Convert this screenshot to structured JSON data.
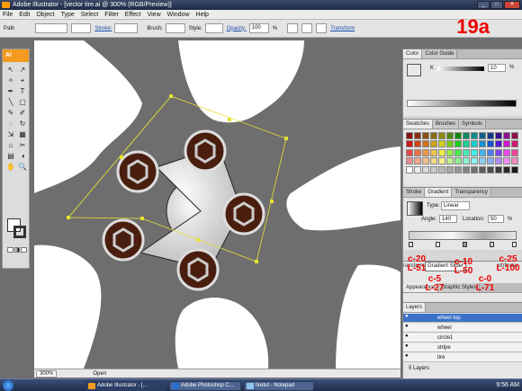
{
  "window": {
    "title": "Adobe Illustrator - [vector tire.ai @ 300% (RGB/Preview)]",
    "min": "_",
    "max": "□",
    "close": "✕"
  },
  "menu": [
    "File",
    "Edit",
    "Object",
    "Type",
    "Select",
    "Filter",
    "Effect",
    "View",
    "Window",
    "Help"
  ],
  "control": {
    "path_label": "Path",
    "stroke_label": "Stroke:",
    "brush_label": "Brush:",
    "style_label": "Style:",
    "opacity_label": "Opacity:",
    "opacity_value": "100",
    "opacity_unit": "%",
    "transform_label": "Transform"
  },
  "step_badge": "19a",
  "toolbox": {
    "logo": "Ai",
    "tools": [
      "↖",
      "↗",
      "✧",
      "⌖",
      "✒",
      "T",
      "╲",
      "▢",
      "✎",
      "✐",
      "◌",
      "↻",
      "⇲",
      "▦",
      "⌂",
      "✂",
      "▤",
      "◑",
      "✋",
      "🔍"
    ]
  },
  "color_panel": {
    "tabs": [
      "Color",
      "Color Guide"
    ],
    "channel": "K",
    "value": "10",
    "unit": "%"
  },
  "swatches_panel": {
    "tabs": [
      "Swatches",
      "Brushes",
      "Symbols"
    ]
  },
  "gradient_panel": {
    "tabs": [
      "Stroke",
      "Gradient",
      "Transparency"
    ],
    "type_label": "Type:",
    "type_value": "Linear",
    "angle_label": "Angle:",
    "angle_value": "140",
    "location_label": "Location:",
    "location_value": "50",
    "unit": "%"
  },
  "appearance_panel": {
    "tabs": [
      "Appearance",
      "Graphic Styles"
    ],
    "gradient_slider_label": "Gradient Slider",
    "hidden_tab_left": "ransform",
    "hidden_tab_right": "athfinder"
  },
  "annotations": {
    "c20": "c-20",
    "l51": "L-51",
    "c10": "c-10",
    "l50": "L-50",
    "c25": "c-25",
    "l100": "L-100",
    "c5": "c-5",
    "l27": "L-27",
    "c0": "c-0",
    "l71": "L-71"
  },
  "layers_panel": {
    "tab": "Layers",
    "count": "5 Layers",
    "layers": [
      "wheel top",
      "wheel",
      "circle1",
      "stripe",
      "tire"
    ]
  },
  "status": {
    "zoom": "300%",
    "mode": "Open"
  },
  "taskbar": {
    "items": [
      "Adobe Illustrator - [...",
      "Adobe Photoshop C...",
      "tiretut - Notepad"
    ],
    "clock": "9:56 AM"
  },
  "colors": {
    "illustrator_orange": "#f39a1f",
    "lug_brown": "#4a1e0f",
    "guide_yellow": "#e6e034",
    "annotation_red": "#e00000",
    "layer_selected": "#3a72c8"
  }
}
